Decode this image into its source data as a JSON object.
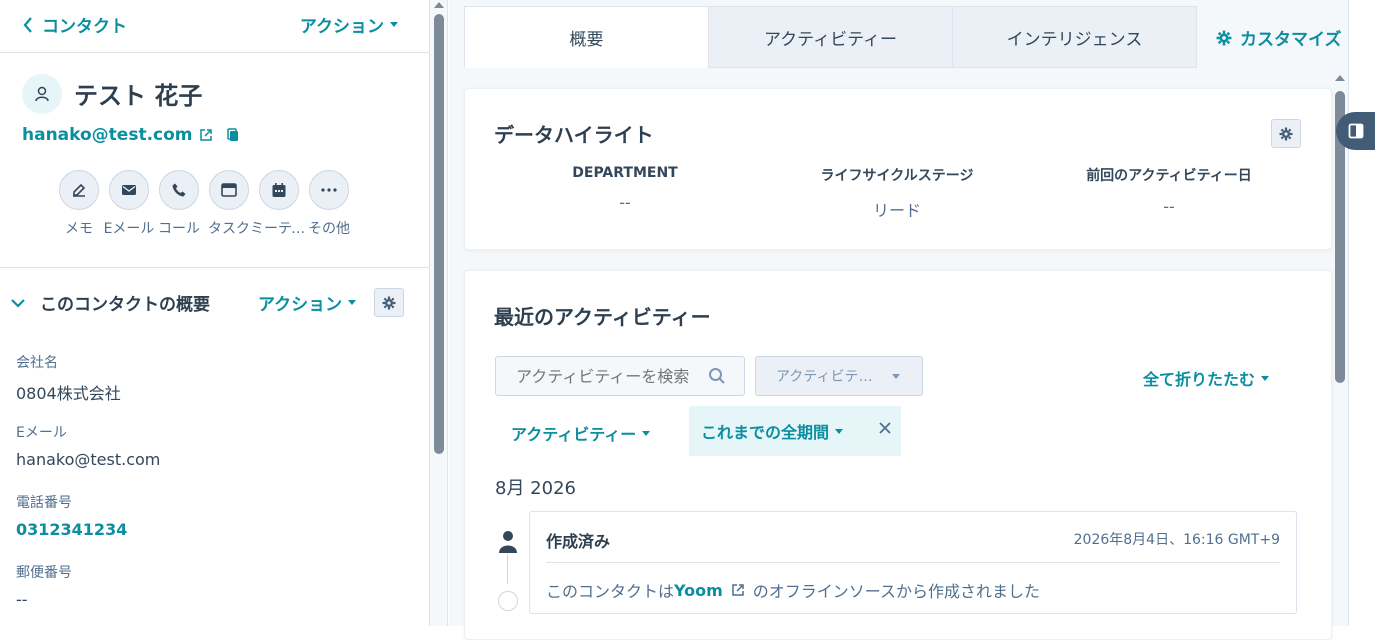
{
  "left": {
    "back_label": "コンタクト",
    "top_action": "アクション",
    "name": "テスト 花子",
    "email": "hanako@test.com",
    "actions": [
      {
        "icon": "edit-icon",
        "label": "メモ"
      },
      {
        "icon": "email-icon",
        "label": "Eメール"
      },
      {
        "icon": "phone-icon",
        "label": "コール"
      },
      {
        "icon": "task-icon",
        "label": "タスク"
      },
      {
        "icon": "calendar-icon",
        "label": "ミーティング"
      },
      {
        "icon": "more-icon",
        "label": "その他"
      }
    ],
    "section": {
      "title": "このコンタクトの概要",
      "action": "アクション"
    },
    "properties": [
      {
        "label": "会社名",
        "value": "0804株式会社"
      },
      {
        "label": "Eメール",
        "value": "hanako@test.com"
      },
      {
        "label": "電話番号",
        "value": "0312341234"
      },
      {
        "label": "郵便番号",
        "value": "--"
      }
    ]
  },
  "right": {
    "tabs": [
      "概要",
      "アクティビティー",
      "インテリジェンス"
    ],
    "customize": "カスタマイズ",
    "highlights": {
      "title": "データハイライト",
      "cols": [
        {
          "key": "DEPARTMENT",
          "value": "--"
        },
        {
          "key": "ライフサイクルステージ",
          "value": "リード"
        },
        {
          "key": "前回のアクティビティー日",
          "value": "--"
        }
      ]
    },
    "activity": {
      "title": "最近のアクティビティー",
      "search_placeholder": "アクティビティーを検索",
      "filter_label": "アクティビテ…",
      "collapse_all": "全て折りたたむ",
      "activity_filter": "アクティビティー",
      "period": "これまでの全期間",
      "month": "8月 2026",
      "entry": {
        "title": "作成済み",
        "date": "2026年8月4日、16:16 GMT+9",
        "body_prefix": "このコンタクトは",
        "body_link": "Yoom",
        "body_suffix": "のオフラインソースから作成されました"
      }
    }
  },
  "colors": {
    "accent": "#0b8ea0",
    "text": "#33475b",
    "bg": "#f5f8fa"
  }
}
